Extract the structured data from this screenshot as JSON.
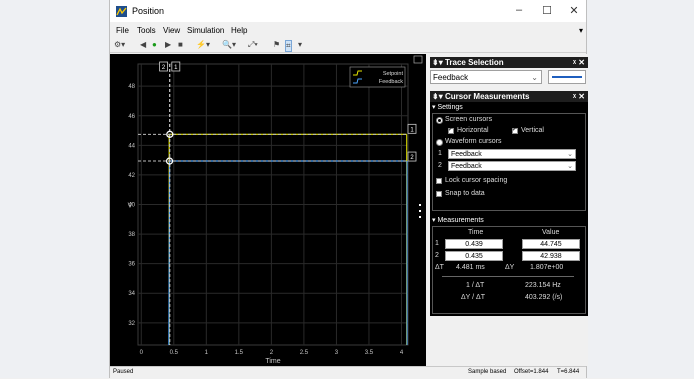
{
  "window": {
    "title": "Position"
  },
  "menu": [
    "File",
    "Tools",
    "View",
    "Simulation",
    "Help"
  ],
  "plot": {
    "xlabel": "Time",
    "ylabel": "V",
    "xticks": [
      "0",
      "0.5",
      "1",
      "1.5",
      "2",
      "2.5",
      "3",
      "3.5",
      "4"
    ],
    "yticks": [
      "32",
      "34",
      "36",
      "38",
      "40",
      "42",
      "44",
      "46",
      "48"
    ],
    "legend": [
      "Setpoint",
      "Feedback"
    ],
    "cursor_tags": [
      "2",
      "1"
    ],
    "level_tags": [
      "1",
      "2"
    ],
    "colors": {
      "setpoint": "#e6e600",
      "feedback": "#4da6ff",
      "grid": "#2a2a2a",
      "background": "#000000"
    }
  },
  "chart_data": {
    "type": "line",
    "xlabel": "Time",
    "ylabel": "V",
    "xlim": [
      -0.05,
      4.1
    ],
    "ylim": [
      30.5,
      49.5
    ],
    "series": [
      {
        "name": "Setpoint",
        "x": [
          0.43,
          0.43,
          4.08
        ],
        "y": [
          30.5,
          44.745,
          44.745
        ]
      },
      {
        "name": "Feedback",
        "x": [
          0.425,
          0.435,
          0.44,
          4.08
        ],
        "y": [
          30.5,
          42.938,
          42.938,
          42.938
        ]
      }
    ],
    "cursors": {
      "1": {
        "time": 0.439,
        "value": 44.745
      },
      "2": {
        "time": 0.435,
        "value": 42.938
      }
    }
  },
  "trace_selection": {
    "title": "Trace Selection",
    "selected": "Feedback"
  },
  "cursor_measurements": {
    "title": "Cursor Measurements",
    "settings_label": "Settings",
    "screen_cursors": "Screen cursors",
    "horizontal": "Horizontal",
    "vertical": "Vertical",
    "waveform_cursors": "Waveform cursors",
    "wf1_num": "1",
    "wf1": "Feedback",
    "wf2_num": "2",
    "wf2": "Feedback",
    "lock_spacing": "Lock cursor spacing",
    "snap": "Snap to data",
    "measurements_label": "Measurements",
    "col_time": "Time",
    "col_value": "Value",
    "row1_num": "1",
    "row1_time": "0.439",
    "row1_value": "44.745",
    "row2_num": "2",
    "row2_time": "0.435",
    "row2_value": "42.938",
    "dt_label": "ΔT",
    "dt_value": "4.481 ms",
    "dy_label": "ΔY",
    "dy_value": "1.807e+00",
    "inv_dt_label": "1 / ΔT",
    "inv_dt_value": "223.154 Hz",
    "slope_label": "ΔY / ΔT",
    "slope_value": "403.292 (/s)"
  },
  "status": {
    "state": "Paused",
    "mode": "Sample based",
    "offset": "Offset=1.844",
    "time": "T=6.844"
  }
}
